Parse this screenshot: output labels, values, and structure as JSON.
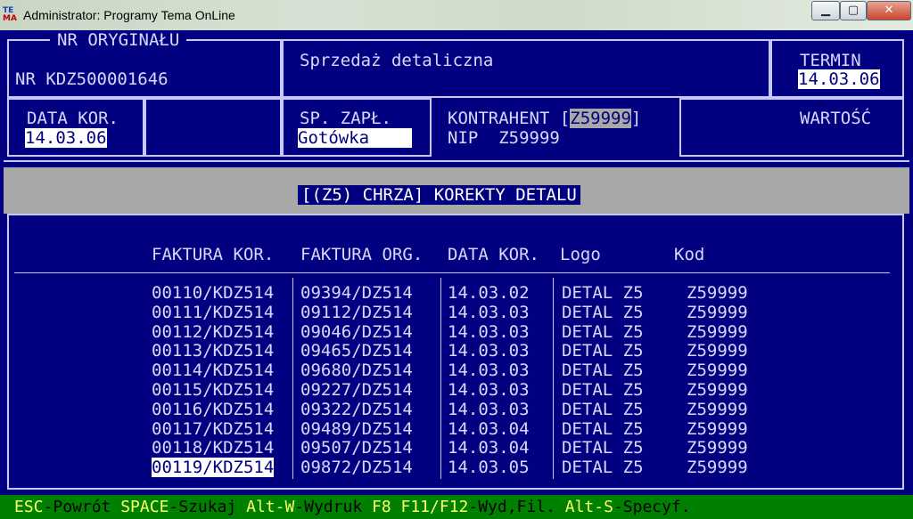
{
  "window": {
    "title": "Administrator:  Programy Tema OnLine",
    "icon_top": "TE",
    "icon_bottom": "MA",
    "minimize": "▁",
    "maximize": "▢",
    "close": "✕"
  },
  "header": {
    "nr_oryginalu_label": "NR ORYGINAŁU",
    "nr_value": "NR KDZ500001646",
    "doc_type": "Sprzedaż detaliczna",
    "termin_label": "TERMIN",
    "termin_value": "14.03.06",
    "data_kor_label": "DATA KOR.",
    "data_kor_value": "14.03.06",
    "sp_zapl_label": "SP. ZAPŁ.",
    "sp_zapl_value": "Gotówka",
    "kontrahent_label": "KONTRAHENT",
    "kontrahent_value": "Z59999",
    "nip_label": "NIP",
    "nip_value": "Z59999",
    "wartosc_label": "WARTOŚĆ"
  },
  "section_title": "[(Z5) CHRZA] KOREKTY DETALU",
  "table": {
    "columns": [
      "FAKTURA KOR.",
      "FAKTURA ORG.",
      "DATA KOR.",
      "Logo",
      "Kod"
    ],
    "rows": [
      [
        "00110/KDZ514",
        "09394/DZ514",
        "14.03.02",
        "DETAL Z5",
        "Z59999"
      ],
      [
        "00111/KDZ514",
        "09112/DZ514",
        "14.03.03",
        "DETAL Z5",
        "Z59999"
      ],
      [
        "00112/KDZ514",
        "09046/DZ514",
        "14.03.03",
        "DETAL Z5",
        "Z59999"
      ],
      [
        "00113/KDZ514",
        "09465/DZ514",
        "14.03.03",
        "DETAL Z5",
        "Z59999"
      ],
      [
        "00114/KDZ514",
        "09680/DZ514",
        "14.03.03",
        "DETAL Z5",
        "Z59999"
      ],
      [
        "00115/KDZ514",
        "09227/DZ514",
        "14.03.03",
        "DETAL Z5",
        "Z59999"
      ],
      [
        "00116/KDZ514",
        "09322/DZ514",
        "14.03.03",
        "DETAL Z5",
        "Z59999"
      ],
      [
        "00117/KDZ514",
        "09489/DZ514",
        "14.03.04",
        "DETAL Z5",
        "Z59999"
      ],
      [
        "00118/KDZ514",
        "09507/DZ514",
        "14.03.04",
        "DETAL Z5",
        "Z59999"
      ],
      [
        "00119/KDZ514",
        "09872/DZ514",
        "14.03.05",
        "DETAL Z5",
        "Z59999"
      ]
    ],
    "selected_row": 9
  },
  "footer": {
    "k1": "ESC",
    "d1": "-Powrót ",
    "k2": "SPACE",
    "d2": "-Szukaj ",
    "k3": "Alt-W",
    "d3": "-Wydruk ",
    "k4": "F8 F11/F12",
    "d4": "-Wyd,Fil. ",
    "k5": "Alt-S",
    "d5": "-Specyf."
  },
  "colors": {
    "background": "#000080",
    "text": "#d8d8ff",
    "highlight_bg": "#ffffff",
    "band": "#a8a8a8",
    "footer_bg": "#008000",
    "footer_key": "#ffff66"
  }
}
